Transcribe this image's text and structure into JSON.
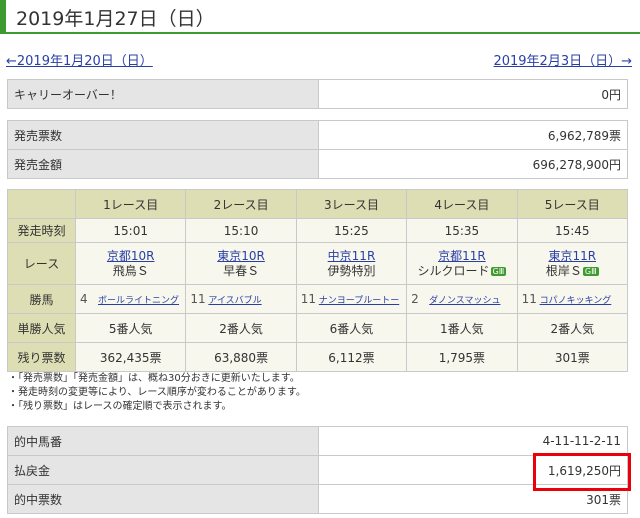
{
  "page_title": "2019年1月27日（日）",
  "nav": {
    "prev": "←2019年1月20日（日）",
    "next": "2019年2月3日（日）→"
  },
  "carryover": {
    "label": "キャリーオーバー！",
    "value": "0円"
  },
  "sales": {
    "votes_label": "発売票数",
    "votes_value": "6,962,789票",
    "amount_label": "発売金額",
    "amount_value": "696,278,900円"
  },
  "race_table": {
    "header_labels": [
      "1レース目",
      "2レース目",
      "3レース目",
      "4レース目",
      "5レース目"
    ],
    "row_labels": {
      "start_time": "発走時刻",
      "race": "レース",
      "winner": "勝馬",
      "popularity": "単勝人気",
      "remaining": "残り票数"
    },
    "races": [
      {
        "time": "15:01",
        "venue": "京都10R",
        "name": "飛鳥Ｓ",
        "grade": "",
        "horse_num": "4",
        "horse": "ボールライトニング",
        "popularity": "5番人気",
        "remaining": "362,435票"
      },
      {
        "time": "15:10",
        "venue": "東京10R",
        "name": "早春Ｓ",
        "grade": "",
        "horse_num": "11",
        "horse": "アイスバブル",
        "popularity": "2番人気",
        "remaining": "63,880票"
      },
      {
        "time": "15:25",
        "venue": "中京11R",
        "name": "伊勢特別",
        "grade": "",
        "horse_num": "11",
        "horse": "ナンヨープルートー",
        "popularity": "6番人気",
        "remaining": "6,112票"
      },
      {
        "time": "15:35",
        "venue": "京都11R",
        "name": "シルクロード",
        "grade": "GⅢ",
        "horse_num": "2",
        "horse": "ダノンスマッシュ",
        "popularity": "1番人気",
        "remaining": "1,795票"
      },
      {
        "time": "15:45",
        "venue": "東京11R",
        "name": "根岸Ｓ",
        "grade": "GⅢ",
        "horse_num": "11",
        "horse": "コパノキッキング",
        "popularity": "2番人気",
        "remaining": "301票"
      }
    ]
  },
  "notes": [
    "・「発売票数」「発売金額」は、概ね30分おきに更新いたします。",
    "・発走時刻の変更等により、レース順序が変わることがあります。",
    "・「残り票数」はレースの確定順で表示されます。"
  ],
  "result": {
    "winning_label": "的中馬番",
    "winning_value": "4-11-11-2-11",
    "payout_label": "払戻金",
    "payout_value": "1,619,250円",
    "hits_label": "的中票数",
    "hits_value": "301票"
  },
  "colors": {
    "accent": "#3f9b2f",
    "link": "#2a3fa6",
    "highlight": "#e8000b",
    "header_bg": "#dedeb5"
  }
}
